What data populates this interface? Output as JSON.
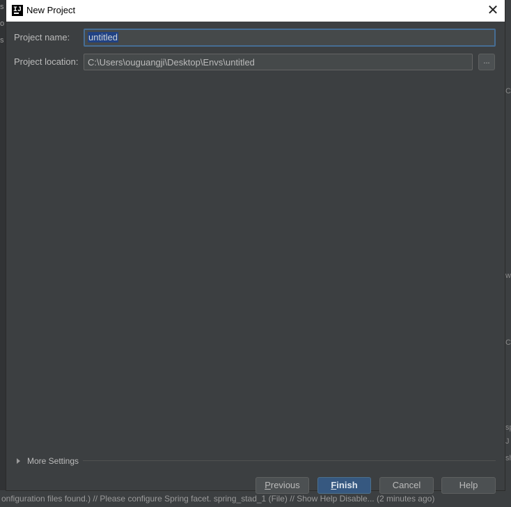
{
  "dialog": {
    "title": "New Project",
    "close_glyph": "✕",
    "app_icon": "intellij-icon"
  },
  "form": {
    "project_name_label": "Project name:",
    "project_name_value": "untitled",
    "project_location_label": "Project location:",
    "project_location_value": "C:\\Users\\ouguangji\\Desktop\\Envs\\untitled",
    "browse_label": "..."
  },
  "more_settings": {
    "label": "More Settings",
    "expanded": false
  },
  "buttons": {
    "previous": "Previous",
    "finish": "Finish",
    "cancel": "Cancel",
    "help": "Help"
  },
  "background": {
    "left_fragments": [
      "s",
      "o",
      "s"
    ],
    "right_fragments": [
      "C",
      "w",
      "C",
      "sp",
      "J",
      "sh"
    ],
    "status_text": "onfiguration files found.) // Please configure Spring facet. spring_stad_1 (File) // Show Help Disable... (2 minutes ago)"
  },
  "colors": {
    "dialog_bg": "#3c3f41",
    "input_bg": "#45494a",
    "focus_border": "#466d94",
    "selection_bg": "#214283",
    "primary_button": "#365880"
  }
}
